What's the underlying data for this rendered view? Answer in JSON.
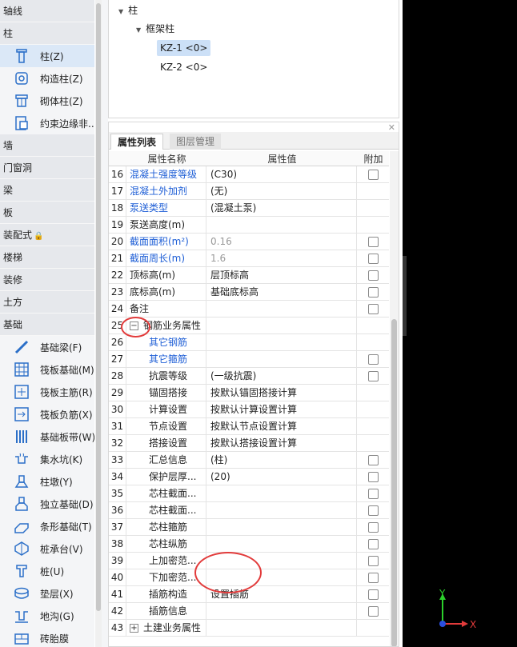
{
  "nav": {
    "categories_top": [
      {
        "label": "轴线"
      },
      {
        "label": "柱"
      }
    ],
    "column_items": [
      {
        "label": "柱(Z)",
        "icon": "column-icon",
        "active": true
      },
      {
        "label": "构造柱(Z)",
        "icon": "constructional-column-icon"
      },
      {
        "label": "砌体柱(Z)",
        "icon": "masonry-column-icon"
      },
      {
        "label": "约束边缘非...",
        "icon": "edge-constraint-icon"
      }
    ],
    "categories_mid": [
      {
        "label": "墙"
      },
      {
        "label": "门窗洞"
      },
      {
        "label": "梁"
      },
      {
        "label": "板"
      },
      {
        "label": "装配式",
        "lock": "lock-icon"
      },
      {
        "label": "楼梯"
      },
      {
        "label": "装修"
      },
      {
        "label": "土方"
      },
      {
        "label": "基础"
      }
    ],
    "foundation_items": [
      {
        "label": "基础梁(F)",
        "icon": "foundation-beam-icon"
      },
      {
        "label": "筏板基础(M)",
        "icon": "raft-foundation-icon"
      },
      {
        "label": "筏板主筋(R)",
        "icon": "raft-main-rebar-icon"
      },
      {
        "label": "筏板负筋(X)",
        "icon": "raft-negative-rebar-icon"
      },
      {
        "label": "基础板带(W)",
        "icon": "foundation-strip-icon"
      },
      {
        "label": "集水坑(K)",
        "icon": "sump-icon"
      },
      {
        "label": "柱墩(Y)",
        "icon": "column-pier-icon"
      },
      {
        "label": "独立基础(D)",
        "icon": "isolated-footing-icon"
      },
      {
        "label": "条形基础(T)",
        "icon": "strip-footing-icon"
      },
      {
        "label": "桩承台(V)",
        "icon": "pile-cap-icon"
      },
      {
        "label": "桩(U)",
        "icon": "pile-icon"
      },
      {
        "label": "垫层(X)",
        "icon": "cushion-icon"
      },
      {
        "label": "地沟(G)",
        "icon": "trench-icon"
      },
      {
        "label": "砖胎膜",
        "icon": "brick-mould-icon"
      }
    ]
  },
  "tree": {
    "root": "柱",
    "child": "框架柱",
    "leaves": [
      "KZ-1 <0>",
      "KZ-2 <0>"
    ]
  },
  "props": {
    "tabs": [
      "属性列表",
      "图层管理"
    ],
    "headers": {
      "name": "属性名称",
      "value": "属性值",
      "add": "附加"
    },
    "rows": [
      {
        "n": "16",
        "name": "混凝土强度等级",
        "value": "(C30)",
        "blue": true,
        "cb": true
      },
      {
        "n": "17",
        "name": "混凝土外加剂",
        "value": "(无)",
        "blue": true,
        "cb": false
      },
      {
        "n": "18",
        "name": "泵送类型",
        "value": "(混凝土泵)",
        "blue": true,
        "cb": false
      },
      {
        "n": "19",
        "name": "泵送高度(m)",
        "value": "",
        "cb": false
      },
      {
        "n": "20",
        "name": "截面面积(m²)",
        "value": "0.16",
        "blue": true,
        "grayval": true,
        "cb": true
      },
      {
        "n": "21",
        "name": "截面周长(m)",
        "value": "1.6",
        "blue": true,
        "grayval": true,
        "cb": true
      },
      {
        "n": "22",
        "name": "顶标高(m)",
        "value": "层顶标高",
        "cb": true
      },
      {
        "n": "23",
        "name": "底标高(m)",
        "value": "基础底标高",
        "cb": true
      },
      {
        "n": "24",
        "name": "备注",
        "value": "",
        "cb": true
      },
      {
        "n": "25",
        "name": "钢筋业务属性",
        "value": "",
        "group": "−",
        "cb": false
      },
      {
        "n": "26",
        "name": "其它钢筋",
        "value": "",
        "blue": true,
        "indent": 2,
        "cb": false
      },
      {
        "n": "27",
        "name": "其它箍筋",
        "value": "",
        "blue": true,
        "indent": 2,
        "cb": true
      },
      {
        "n": "28",
        "name": "抗震等级",
        "value": "(一级抗震)",
        "indent": 2,
        "cb": true
      },
      {
        "n": "29",
        "name": "锚固搭接",
        "value": "按默认锚固搭接计算",
        "indent": 2,
        "cb": false
      },
      {
        "n": "30",
        "name": "计算设置",
        "value": "按默认计算设置计算",
        "indent": 2,
        "cb": false
      },
      {
        "n": "31",
        "name": "节点设置",
        "value": "按默认节点设置计算",
        "indent": 2,
        "cb": false
      },
      {
        "n": "32",
        "name": "搭接设置",
        "value": "按默认搭接设置计算",
        "indent": 2,
        "cb": false
      },
      {
        "n": "33",
        "name": "汇总信息",
        "value": "(柱)",
        "indent": 2,
        "cb": true
      },
      {
        "n": "34",
        "name": "保护层厚...",
        "value": "(20)",
        "indent": 2,
        "cb": true
      },
      {
        "n": "35",
        "name": "芯柱截面...",
        "value": "",
        "indent": 2,
        "cb": true
      },
      {
        "n": "36",
        "name": "芯柱截面...",
        "value": "",
        "indent": 2,
        "cb": true
      },
      {
        "n": "37",
        "name": "芯柱箍筋",
        "value": "",
        "indent": 2,
        "cb": true
      },
      {
        "n": "38",
        "name": "芯柱纵筋",
        "value": "",
        "indent": 2,
        "cb": true
      },
      {
        "n": "39",
        "name": "上加密范...",
        "value": "",
        "indent": 2,
        "cb": true
      },
      {
        "n": "40",
        "name": "下加密范...",
        "value": "",
        "indent": 2,
        "cb": true
      },
      {
        "n": "41",
        "name": "插筋构造",
        "value": "设置插筋",
        "indent": 2,
        "cb": true
      },
      {
        "n": "42",
        "name": "插筋信息",
        "value": "",
        "indent": 2,
        "cb": true
      },
      {
        "n": "43",
        "name": "土建业务属性",
        "value": "",
        "group": "+",
        "cb": false
      }
    ]
  },
  "axes": {
    "y": "Y",
    "x": "X"
  }
}
